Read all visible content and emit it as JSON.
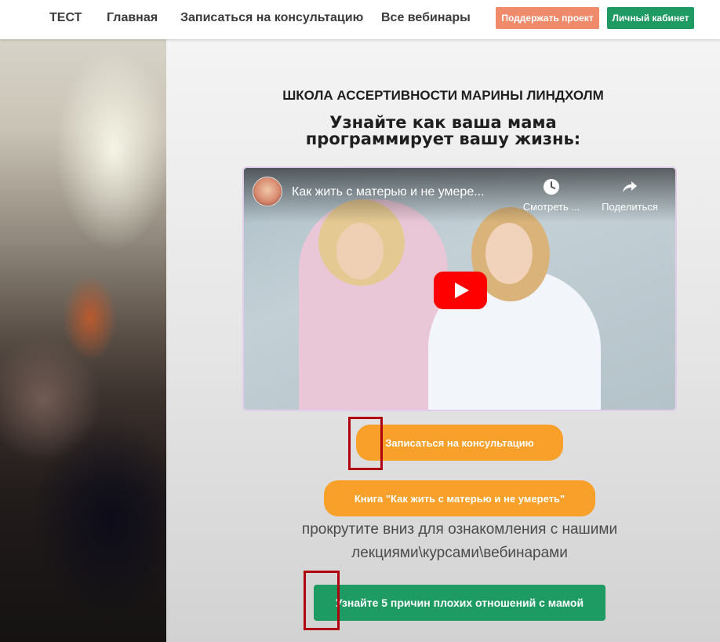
{
  "header": {
    "nav": [
      {
        "label": "ТЕСТ"
      },
      {
        "label": "Главная"
      },
      {
        "label": "Записаться на консультацию"
      },
      {
        "label": "Все вебинары"
      }
    ],
    "support_button": "Поддержать проект",
    "cabinet_button": "Личный кабинет"
  },
  "main": {
    "school_title": "ШКОЛА АССЕРТИВНОСТИ МАРИНЫ ЛИНДХОЛМ",
    "headline_line1": "Узнайте как ваша мама",
    "headline_line2": "программирует вашу жизнь:",
    "video": {
      "title": "Как жить с матерью и не умере...",
      "watch_later_label": "Смотреть ...",
      "share_label": "Поделиться"
    },
    "consult_button": "Записаться на консультацию",
    "book_button": "Книга \"Как жить с матерью и не умереть\"",
    "scroll_hint_line1": "прокрутите вниз для ознакомления с нашими",
    "scroll_hint_line2": "лекциями\\курсами\\вебинарами",
    "reasons_button": "Узнайте 5 причин плохих отношений с мамой"
  },
  "colors": {
    "orange_button": "#f8a02a",
    "green_button": "#1e9b62",
    "support_button": "#ef8a6a",
    "highlight_box": "#b0000f"
  }
}
